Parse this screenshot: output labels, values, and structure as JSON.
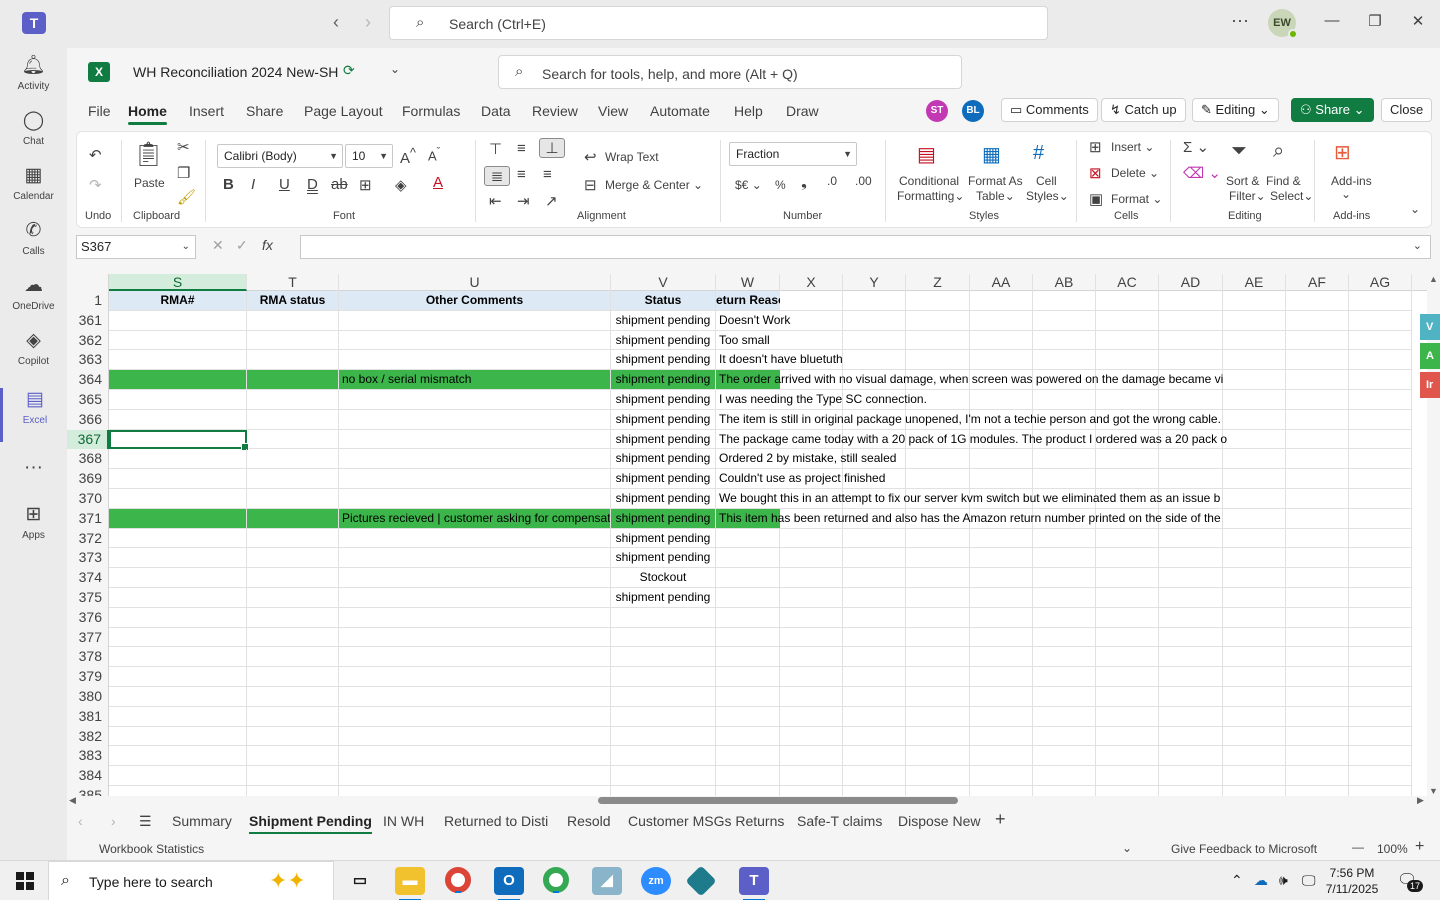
{
  "teams": {
    "search_placeholder": "Search (Ctrl+E)",
    "user_initials": "EW",
    "rail": [
      {
        "label": "Activity"
      },
      {
        "label": "Chat"
      },
      {
        "label": "Calendar"
      },
      {
        "label": "Calls"
      },
      {
        "label": "OneDrive"
      },
      {
        "label": "Copilot"
      },
      {
        "label": "Excel"
      },
      {
        "label": "Apps"
      }
    ]
  },
  "workbook": {
    "title": "WH Reconciliation 2024 New-SH",
    "tool_search_placeholder": "Search for tools, help, and more (Alt + Q)"
  },
  "menu": {
    "tabs": [
      "File",
      "Home",
      "Insert",
      "Share",
      "Page Layout",
      "Formulas",
      "Data",
      "Review",
      "View",
      "Automate",
      "Help",
      "Draw"
    ],
    "active": "Home",
    "presence": [
      {
        "initials": "ST",
        "color": "#c239b3"
      },
      {
        "initials": "BL",
        "color": "#0f6cbd"
      }
    ],
    "comments": "Comments",
    "catch_up": "Catch up",
    "editing": "Editing",
    "share": "Share",
    "close": "Close"
  },
  "ribbon": {
    "undo_group": "Undo",
    "paste": "Paste",
    "clipboard": "Clipboard",
    "font_name": "Calibri (Body)",
    "font_size": "10",
    "font_group": "Font",
    "wrap_text": "Wrap Text",
    "merge_center": "Merge & Center",
    "alignment_group": "Alignment",
    "number_format": "Fraction",
    "currency": "$€",
    "percent": "%",
    "number_group": "Number",
    "conditional_1": "Conditional",
    "conditional_2": "Formatting",
    "format_as_1": "Format As",
    "format_as_2": "Table",
    "cell_styles_1": "Cell",
    "cell_styles_2": "Styles",
    "styles_group": "Styles",
    "insert": "Insert",
    "delete": "Delete",
    "format": "Format",
    "cells_group": "Cells",
    "sort_1": "Sort &",
    "sort_2": "Filter",
    "find_1": "Find &",
    "find_2": "Select",
    "editing_group": "Editing",
    "addins": "Add-ins",
    "addins_group": "Add-ins"
  },
  "formula_bar": {
    "name_box": "S367",
    "fx": "fx",
    "value": ""
  },
  "grid": {
    "columns": [
      "S",
      "T",
      "U",
      "V",
      "W",
      "X",
      "Y",
      "Z",
      "AA",
      "AB",
      "AC",
      "AD",
      "AE",
      "AF",
      "AG"
    ],
    "selected_column": "S",
    "header_row": {
      "row": "1",
      "S": "RMA#",
      "T": "RMA status",
      "U": "Other Comments",
      "V": "Status",
      "W": "eturn Reason"
    },
    "rows": [
      {
        "row": "361",
        "U": "",
        "V": "shipment pending",
        "W": "Doesn't Work"
      },
      {
        "row": "362",
        "U": "",
        "V": "shipment pending",
        "W": "Too small"
      },
      {
        "row": "363",
        "U": "",
        "V": "shipment pending",
        "W": "It doesn't have bluetuth"
      },
      {
        "row": "364",
        "U": "no box / serial mismatch",
        "V": "shipment pending",
        "W": "The order arrived with no visual damage, when screen was powered on the damage became vi",
        "highlight": true
      },
      {
        "row": "365",
        "U": "",
        "V": "shipment pending",
        "W": "I was needing the Type SC connection."
      },
      {
        "row": "366",
        "U": "",
        "V": "shipment pending",
        "W": "The item is still in original package unopened, I'm not a techie person and got the wrong cable."
      },
      {
        "row": "367",
        "U": "",
        "V": "shipment pending",
        "W": "The package came today with a 20 pack of 1G modules.  The product I ordered was a 20 pack o",
        "selected": true
      },
      {
        "row": "368",
        "U": "",
        "V": "shipment pending",
        "W": "Ordered 2 by mistake, still sealed"
      },
      {
        "row": "369",
        "U": "",
        "V": "shipment pending",
        "W": "Couldn't use as project finished"
      },
      {
        "row": "370",
        "U": "",
        "V": "shipment pending",
        "W": "We bought this in an attempt to fix our server kvm switch but we eliminated them as an issue b"
      },
      {
        "row": "371",
        "U": "Pictures recieved | customer asking for compensat",
        "V": "shipment pending",
        "W": "This item has been returned and also has the Amazon return number printed on the side of the",
        "highlight": true
      },
      {
        "row": "372",
        "U": "",
        "V": "shipment pending",
        "W": ""
      },
      {
        "row": "373",
        "U": "",
        "V": "shipment pending",
        "W": ""
      },
      {
        "row": "374",
        "U": "",
        "V": "Stockout",
        "W": ""
      },
      {
        "row": "375",
        "U": "",
        "V": "shipment pending",
        "W": ""
      },
      {
        "row": "376",
        "U": "",
        "V": "",
        "W": ""
      },
      {
        "row": "377",
        "U": "",
        "V": "",
        "W": ""
      },
      {
        "row": "378",
        "U": "",
        "V": "",
        "W": ""
      },
      {
        "row": "379",
        "U": "",
        "V": "",
        "W": ""
      },
      {
        "row": "380",
        "U": "",
        "V": "",
        "W": ""
      },
      {
        "row": "381",
        "U": "",
        "V": "",
        "W": ""
      },
      {
        "row": "382",
        "U": "",
        "V": "",
        "W": ""
      },
      {
        "row": "383",
        "U": "",
        "V": "",
        "W": ""
      },
      {
        "row": "384",
        "U": "",
        "V": "",
        "W": ""
      },
      {
        "row": "385",
        "U": "",
        "V": "",
        "W": ""
      }
    ],
    "highlight_color": "#3cb54a",
    "side_tags": [
      {
        "label": "V",
        "color": "#4fb3c4"
      },
      {
        "label": "A",
        "color": "#3cb54a"
      },
      {
        "label": "Ir",
        "color": "#e0564c"
      }
    ]
  },
  "sheets": {
    "tabs": [
      "Summary",
      "Shipment Pending",
      "IN WH",
      "Returned to Disti",
      "Resold",
      "Customer MSGs Returns",
      "Safe-T claims",
      "Dispose New"
    ],
    "active": "Shipment Pending"
  },
  "status_bar": {
    "left": "Workbook Statistics",
    "feedback": "Give Feedback to Microsoft",
    "zoom": "100%"
  },
  "taskbar": {
    "search_placeholder": "Type here to search",
    "time": "7:56 PM",
    "date": "7/11/2025",
    "notifications": "17"
  }
}
